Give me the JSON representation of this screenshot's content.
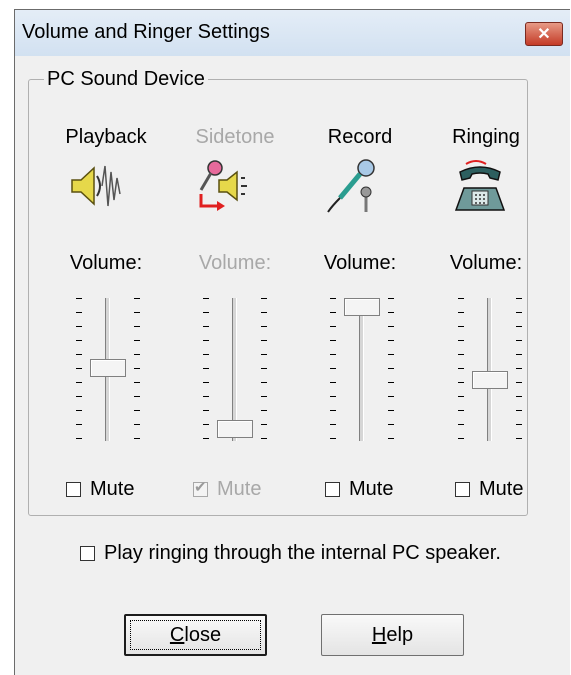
{
  "window": {
    "title": "Volume and Ringer Settings"
  },
  "group": {
    "title": "PC Sound Device"
  },
  "columns": [
    {
      "label": "Playback",
      "icon": "speaker-icon",
      "volume_label": "Volume:",
      "volume_level": 0.5,
      "mute_label": "Mute",
      "muted": false,
      "enabled": true
    },
    {
      "label": "Sidetone",
      "icon": "microphone-speaker-icon",
      "volume_label": "Volume:",
      "volume_level": 0.0,
      "mute_label": "Mute",
      "muted": true,
      "enabled": false
    },
    {
      "label": "Record",
      "icon": "microphone-icon",
      "volume_label": "Volume:",
      "volume_level": 1.0,
      "mute_label": "Mute",
      "muted": false,
      "enabled": true
    },
    {
      "label": "Ringing",
      "icon": "telephone-icon",
      "volume_label": "Volume:",
      "volume_level": 0.4,
      "mute_label": "Mute",
      "muted": false,
      "enabled": true
    }
  ],
  "speaker_option": {
    "label": "Play ringing through the internal PC speaker.",
    "checked": false
  },
  "buttons": {
    "close": "Close",
    "help": "Help"
  },
  "colors": {
    "title_close_button": "#c43b27",
    "title_bar": "#d2e1f1"
  }
}
